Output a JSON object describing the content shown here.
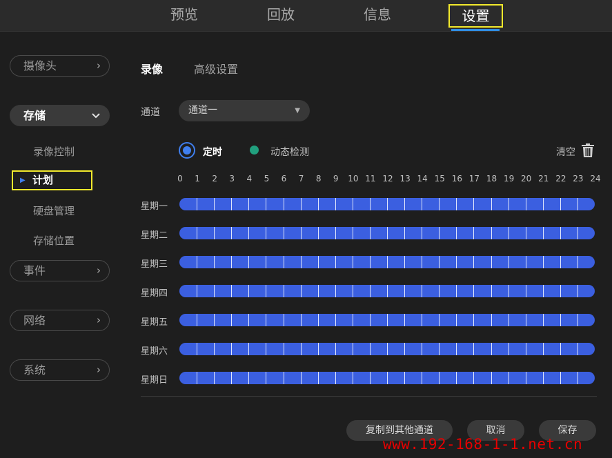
{
  "topnav": {
    "items": [
      {
        "label": "预览"
      },
      {
        "label": "回放"
      },
      {
        "label": "信息"
      },
      {
        "label": "设置"
      }
    ],
    "active_index": 3
  },
  "sidebar": {
    "camera": "摄像头",
    "storage": "存储",
    "storage_sub": {
      "record_control": "录像控制",
      "schedule": "计划",
      "disk_mgmt": "硬盘管理",
      "storage_location": "存储位置"
    },
    "event": "事件",
    "network": "网络",
    "system": "系统"
  },
  "subtabs": {
    "record": "录像",
    "advanced": "高级设置"
  },
  "channel": {
    "label": "通道",
    "value": "通道一"
  },
  "legend": {
    "timed": "定时",
    "motion": "动态检测"
  },
  "clear_label": "清空",
  "hours": [
    "0",
    "1",
    "2",
    "3",
    "4",
    "5",
    "6",
    "7",
    "8",
    "9",
    "10",
    "11",
    "12",
    "13",
    "14",
    "15",
    "16",
    "17",
    "18",
    "19",
    "20",
    "21",
    "22",
    "23",
    "24"
  ],
  "days": [
    "星期一",
    "星期二",
    "星期三",
    "星期四",
    "星期五",
    "星期六",
    "星期日"
  ],
  "schedule_mode": "定时",
  "colors": {
    "timed": "#3b5fe0",
    "motion": "#21a07e",
    "highlight": "#f3ea2c",
    "accent": "#2f8de4"
  },
  "buttons": {
    "copy": "复制到其他通道",
    "cancel": "取消",
    "save": "保存"
  },
  "watermark": "www.192-168-1-1.net.cn"
}
